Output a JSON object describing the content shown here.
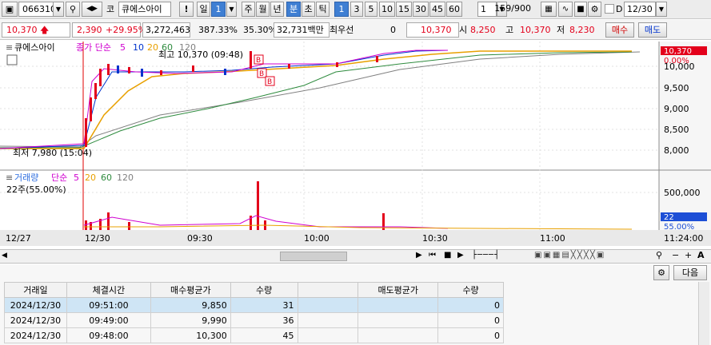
{
  "toolbar": {
    "code": "066310",
    "market": "코",
    "name": "큐에스아이",
    "excl": "!",
    "period_label": "일",
    "period_value": "1",
    "periods": [
      "주",
      "월",
      "년"
    ],
    "tab_min": "분",
    "tab_cho": "초",
    "tab_tick": "틱",
    "intervals": [
      "1",
      "3",
      "5",
      "10",
      "15",
      "30",
      "45",
      "60"
    ],
    "interval_value": "1",
    "count": "159",
    "count_total": "/900",
    "d_label": "D",
    "date": "12/30"
  },
  "info": {
    "price": "10,370",
    "change": "2,390",
    "change_pct": "+29.95%",
    "volume": "3,272,463",
    "vol_ratio": "387.33%",
    "turnover": "35.30%",
    "amount": "32,731백만",
    "priority": "최우선",
    "priority_value": "0",
    "last": "10,370",
    "open_label": "시",
    "open": "8,250",
    "high_label": "고",
    "high": "10,370",
    "low_label": "저",
    "low": "8,230",
    "buy": "매수",
    "sell": "매도"
  },
  "chart": {
    "price_legend_name": "큐에스아이",
    "price_legend_ma": "종가 단순",
    "ma_periods": [
      "5",
      "10",
      "20",
      "60",
      "120"
    ],
    "high_note": "최고 10,370 (09:48)",
    "low_note": "최저 7,980 (15:04)",
    "price_tag": "10,370",
    "price_tag_pct": "0.00%",
    "price_axis": [
      "10,000",
      "9,500",
      "9,000",
      "8,500",
      "8,000"
    ],
    "vol_legend_name": "거래량",
    "vol_legend_ma": "단순",
    "vol_ma_periods": [
      "5",
      "20",
      "60",
      "120"
    ],
    "vol_current": "22주(55.00%)",
    "vol_axis": [
      "500,000"
    ],
    "vol_tag": "22",
    "vol_tag_pct": "55.00%",
    "time_labels": [
      "12/27",
      "12/30",
      "09:30",
      "10:00",
      "10:30",
      "11:00"
    ],
    "time_current": "11:24:00",
    "buy_marker": "B"
  },
  "grid": {
    "next_button": "다음",
    "headers": [
      "거래일",
      "체결시간",
      "매수평균가",
      "수량",
      "",
      "매도평균가",
      "수량"
    ],
    "rows": [
      [
        "2024/12/30",
        "09:51:00",
        "9,850",
        "31",
        "",
        "",
        "0"
      ],
      [
        "2024/12/30",
        "09:49:00",
        "9,990",
        "36",
        "",
        "",
        "0"
      ],
      [
        "2024/12/30",
        "09:48:00",
        "10,300",
        "45",
        "",
        "",
        "0"
      ]
    ]
  },
  "chart_data": {
    "type": "line",
    "series": [],
    "ylim": [
      7800,
      10600
    ]
  }
}
